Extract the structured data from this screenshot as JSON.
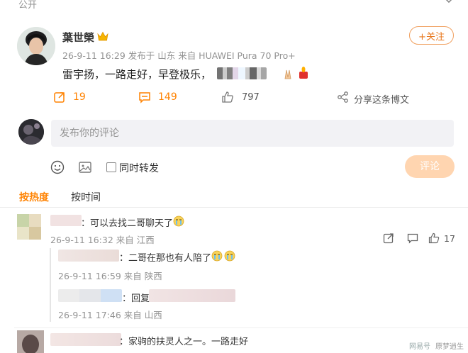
{
  "header": {
    "visibility": "公开",
    "more_icon": "chevron-down-icon"
  },
  "post": {
    "author": "葉世榮",
    "meta": "26-9-11 16:29 发布于 山东 来自 HUAWEI Pura 70 Pro+",
    "content": "雷宇扬，一路走好，早登极乐，",
    "follow_label": "+关注",
    "actions": {
      "repost_count": "19",
      "comment_count": "149",
      "like_count": "797",
      "share_label": "分享这条博文"
    }
  },
  "composer": {
    "placeholder": "发布你的评论",
    "repost_label": "同时转发",
    "submit_label": "评论"
  },
  "sort_tabs": [
    "按热度",
    "按时间"
  ],
  "comments": [
    {
      "text": "：可以去找二哥聊天了",
      "meta": "26-9-11 16:32 来自 江西",
      "like_count": "17"
    },
    {
      "text": "：二哥在那也有人陪了",
      "meta": "26-9-11 16:59 来自 陕西"
    },
    {
      "text": "：回复",
      "meta": "26-9-11 17:46 来自 山西"
    },
    {
      "text": "：家驹的扶灵人之一。一路走好"
    }
  ],
  "watermark": {
    "source": "网易号",
    "author": "原梦逍生"
  },
  "colors": {
    "accent": "#ff8200",
    "follow_border": "#f0a060",
    "submit_bg": "#ffd5b0",
    "input_bg": "#f2f2f5"
  }
}
